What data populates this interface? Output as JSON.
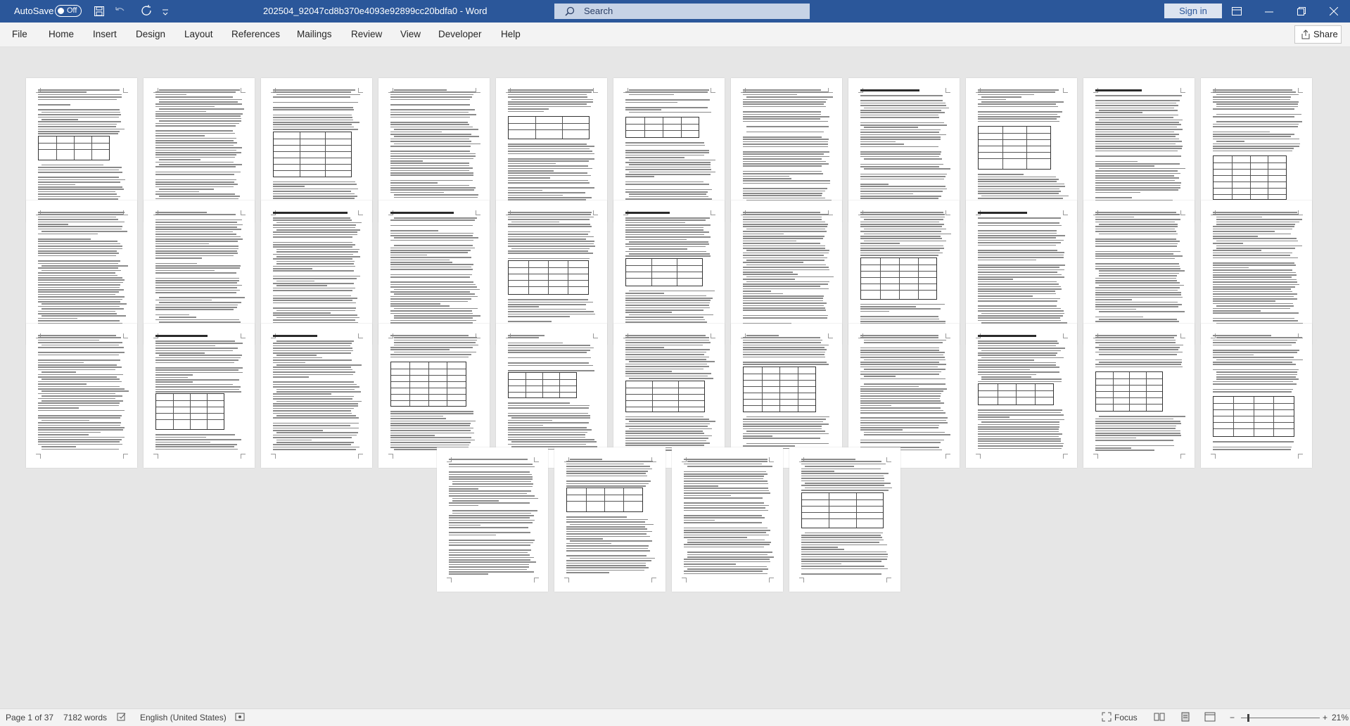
{
  "titlebar": {
    "autosave_label": "AutoSave",
    "autosave_state": "Off",
    "document_title": "202504_92047cd8b370e4093e92899cc20bdfa0  -  Word",
    "search_placeholder": "Search",
    "signin_label": "Sign in",
    "icons": [
      "save-icon",
      "undo-icon",
      "redo-icon",
      "customize-toolbar-icon",
      "ribbon-display-options-icon",
      "minimize-icon",
      "maximize-icon",
      "close-icon"
    ]
  },
  "ribbon": {
    "tabs": [
      "File",
      "Home",
      "Insert",
      "Design",
      "Layout",
      "References",
      "Mailings",
      "Review",
      "View",
      "Developer",
      "Help"
    ],
    "share_label": "Share"
  },
  "statusbar": {
    "page_info": "Page 1 of 37",
    "word_count": "7182 words",
    "language": "English (United States)",
    "focus_label": "Focus",
    "zoom_level": "21%",
    "zoom_minus": "−",
    "zoom_plus": "+"
  },
  "document": {
    "page_count_visible": 37,
    "rows": [
      11,
      11,
      11,
      4
    ]
  }
}
